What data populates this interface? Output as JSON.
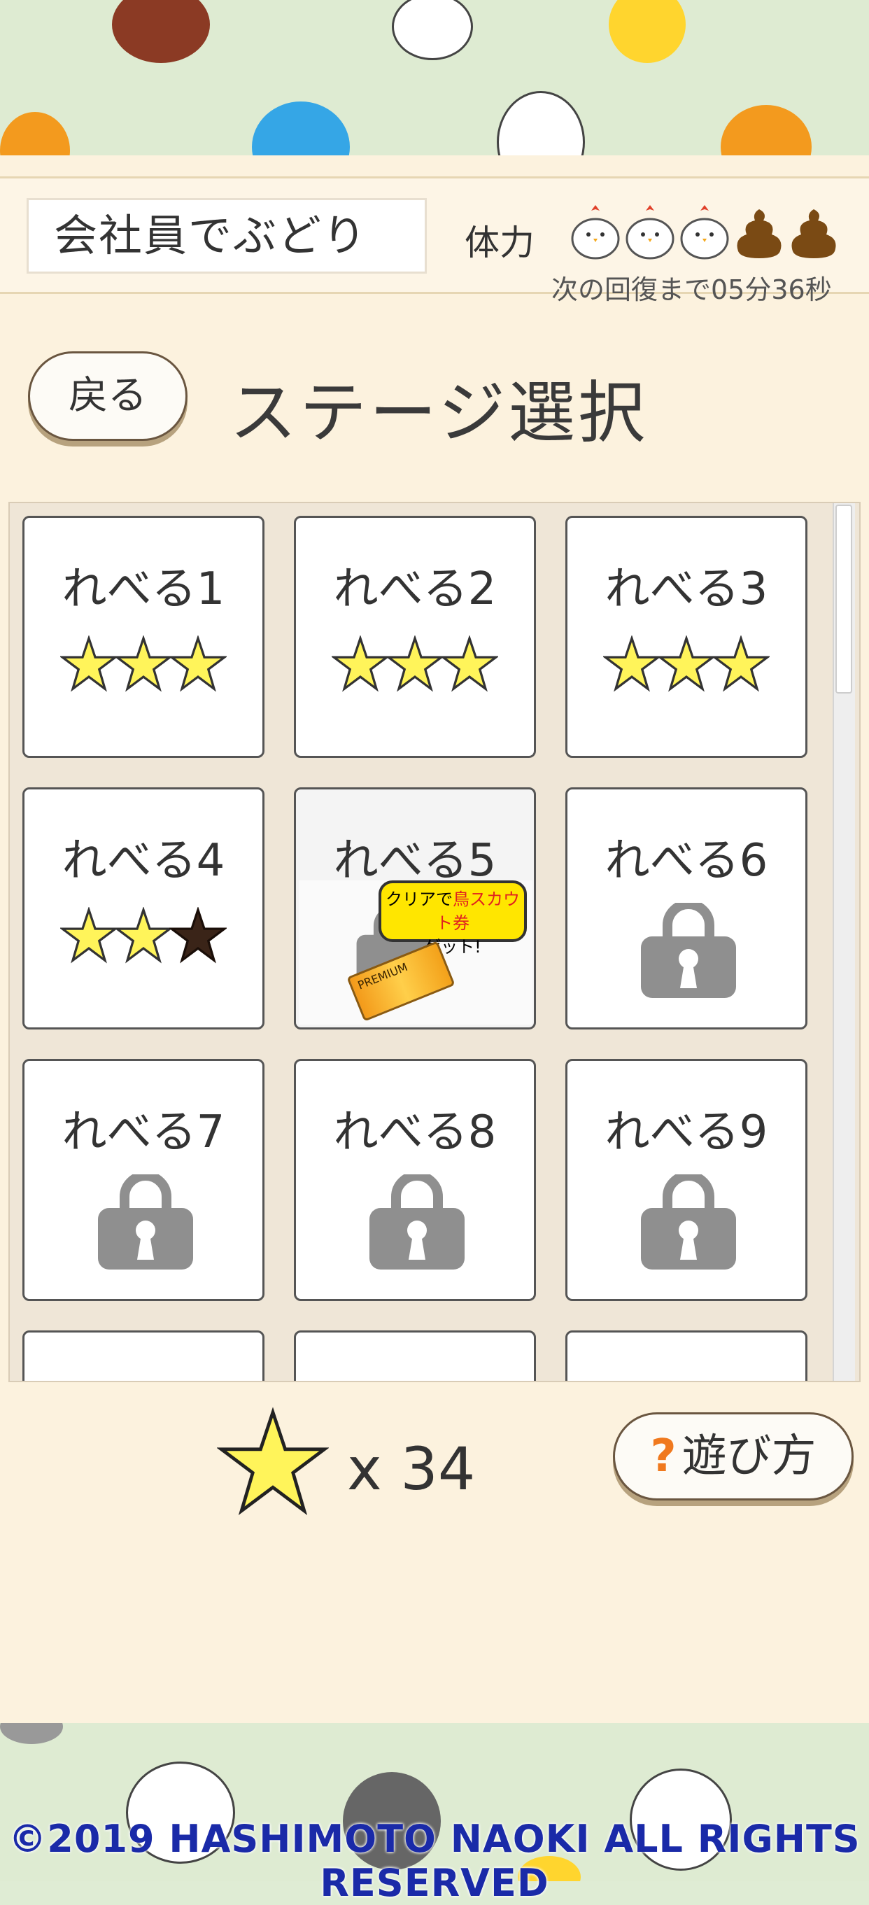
{
  "header": {
    "company_name": "会社員でぶどり",
    "stamina_label": "体力",
    "recovery_text": "次の回復まで05分36秒",
    "stamina_icons": [
      "chick-icon",
      "chick-icon",
      "chick-icon",
      "poop-icon",
      "poop-icon"
    ]
  },
  "nav": {
    "back_label": "戻る",
    "title": "ステージ選択"
  },
  "levels": [
    {
      "label": "れべる1",
      "stars": 3,
      "locked": false
    },
    {
      "label": "れべる2",
      "stars": 3,
      "locked": false
    },
    {
      "label": "れべる3",
      "stars": 3,
      "locked": false
    },
    {
      "label": "れべる4",
      "stars": 2,
      "locked": false
    },
    {
      "label": "れべる5",
      "stars": 0,
      "locked": true,
      "badge_line1_a": "クリアで",
      "badge_line1_b": "鳥スカウト券",
      "badge_line2": "ゲット!",
      "ticket_text": "PREMIUM"
    },
    {
      "label": "れべる6",
      "stars": 0,
      "locked": true
    },
    {
      "label": "れべる7",
      "stars": 0,
      "locked": true
    },
    {
      "label": "れべる8",
      "stars": 0,
      "locked": true
    },
    {
      "label": "れべる9",
      "stars": 0,
      "locked": true
    }
  ],
  "footer": {
    "star_count_text": "x 34",
    "howto_q": "?",
    "howto_label": "遊び方"
  },
  "copyright": "©2019 HASHIMOTO NAOKI ALL RIGHTS RESERVED",
  "colors": {
    "star_fill": "#fff45a",
    "star_empty": "#3a2418",
    "lock": "#8f8f8f",
    "panel": "#fcf2de",
    "accent_orange": "#f0791e"
  }
}
